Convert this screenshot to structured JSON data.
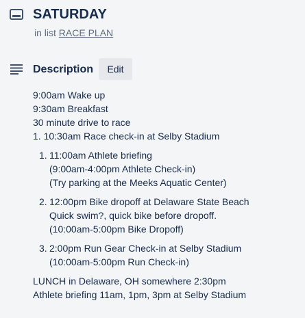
{
  "card": {
    "title": "SATURDAY",
    "in_list_prefix": "in list",
    "list_name": "RACE PLAN",
    "icon": "card-icon"
  },
  "description": {
    "heading": "Description",
    "icon": "description-lines-icon",
    "edit_label": "Edit",
    "intro_lines": [
      "9:00am Wake up",
      "9:30am Breakfast",
      "30 minute drive to race"
    ],
    "numbered_item": "1. 10:30am Race check-in at Selby Stadium",
    "sub_items": [
      {
        "number": "1.",
        "lines": [
          "11:00am Athlete briefing",
          "(9:00am-4:00pm Athlete Check-in)",
          "(Try parking at the Meeks Aquatic Center)"
        ]
      },
      {
        "number": "2.",
        "lines": [
          "12:00pm Bike dropoff at Delaware State Beach",
          "Quick swim?, quick bike before dropoff.",
          "(10:00am-5:00pm Bike Dropoff)"
        ]
      },
      {
        "number": "3.",
        "lines": [
          "2:00pm Run Gear Check-in at Selby Stadium",
          "(10:00am-5:00pm Run Check-in)"
        ]
      }
    ],
    "closing_lines": [
      "LUNCH in Delaware, OH somewhere 2:30pm",
      "Athlete briefing 11am, 1pm, 3pm at Selby Stadium"
    ]
  }
}
